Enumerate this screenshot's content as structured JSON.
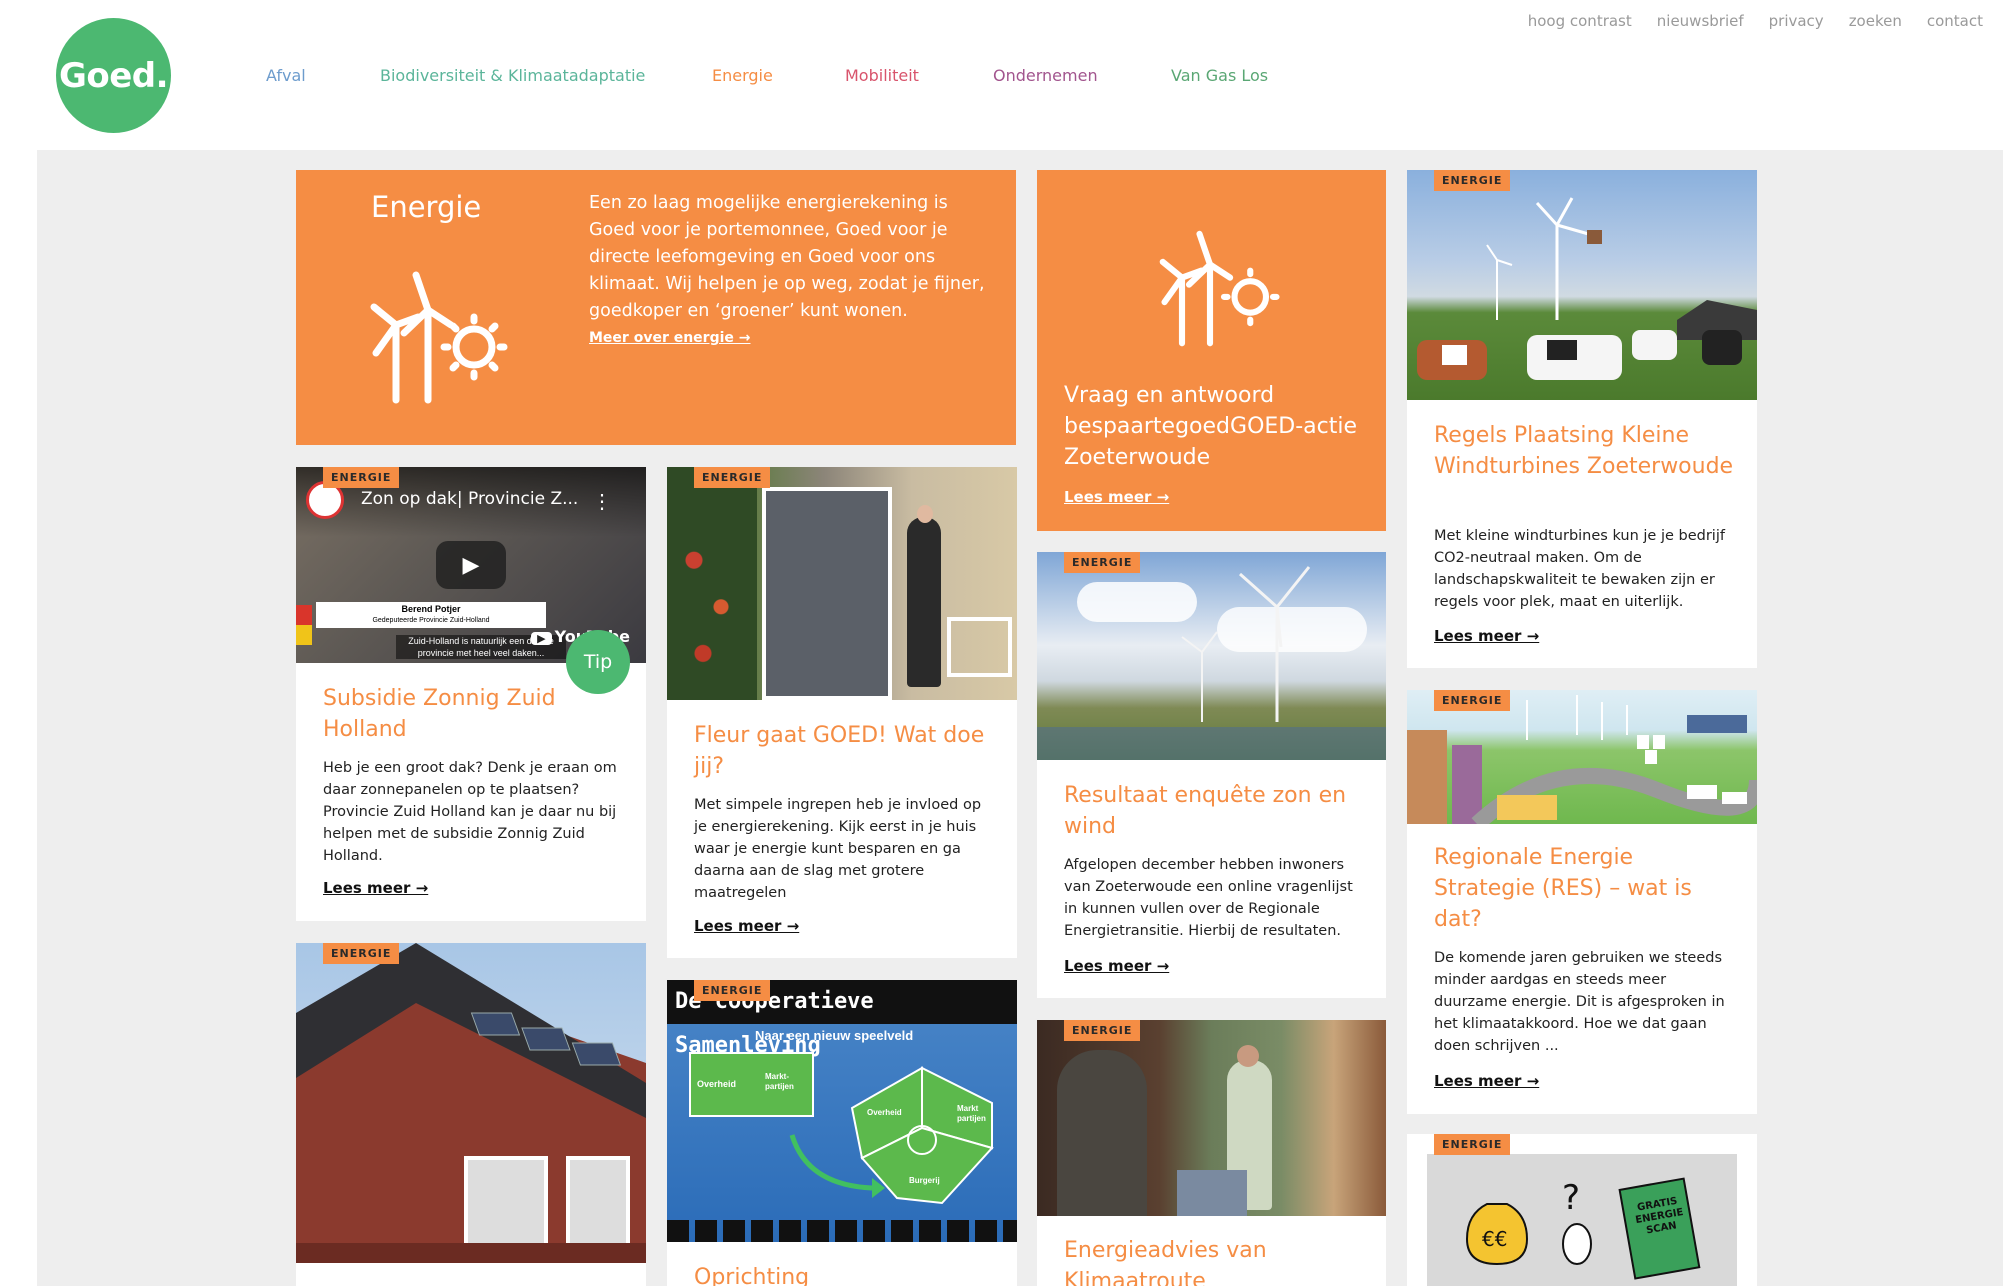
{
  "logo": {
    "text": "Goed."
  },
  "main_nav": [
    {
      "label": "Afval",
      "color": "#6d9ccd"
    },
    {
      "label": "Biodiversiteit & Klimaatadaptatie",
      "color": "#5bb59a"
    },
    {
      "label": "Energie",
      "color": "#f58d44"
    },
    {
      "label": "Mobiliteit",
      "color": "#d8546c"
    },
    {
      "label": "Ondernemen",
      "color": "#a2558e"
    },
    {
      "label": "Van Gas Los",
      "color": "#5aa774"
    }
  ],
  "top_nav": [
    "hoog contrast",
    "nieuwsbrief",
    "privacy",
    "zoeken",
    "contact"
  ],
  "colors": {
    "accent": "#f58d44",
    "green": "#4cb871",
    "bg": "#eeeeee"
  },
  "intro": {
    "title": "Energie",
    "text": "Een zo laag mogelijke energierekening is Goed voor je portemonnee, Goed voor je directe leefomgeving en Goed voor ons klimaat. Wij helpen je op weg, zodat je fijner, goedkoper en ‘groener’ kunt wonen.",
    "link": "Meer over energie →",
    "icon": "wind-solar-icon"
  },
  "badge": "ENERGIE",
  "tip": "Tip",
  "video": {
    "title": "Zon op dak| Provincie Z...",
    "name": "Berend Potjer",
    "role": "Gedeputeerde Provincie Zuid-Holland",
    "caption1": "Zuid-Holland is natuurlijk een drukke",
    "caption2": "provincie met heel veel daken...",
    "brand": "YouTube"
  },
  "cards": {
    "subsidie": {
      "title": "Subsidie Zonnig Zuid Holland",
      "text": "Heb je een groot dak? Denk je eraan om daar zonnepanelen op te plaatsen? Provincie Zuid Holland kan je daar nu bij helpen met de subsidie Zonnig Zuid Holland.",
      "more": "Lees meer →"
    },
    "fleur": {
      "title": "Fleur gaat GOED! Wat doe jij?",
      "text": "Met simpele ingrepen heb je invloed op je energierekening. Kijk eerst in je huis waar je energie kunt besparen en ga daarna aan de slag met grotere maatregelen",
      "more": "Lees meer →"
    },
    "vraag": {
      "title": "Vraag en antwoord bespaartegoedGOED-actie Zoeterwoude",
      "more": "Lees meer →"
    },
    "resultaat": {
      "title": "Resultaat enquête zon en wind",
      "text": "Afgelopen december hebben inwoners van Zoeterwoude een online vragenlijst in kunnen vullen over de Regionale Energietransitie. Hierbij de resultaten.",
      "more": "Lees meer →"
    },
    "advies": {
      "title": "Energieadvies van Klimaatroute"
    },
    "regels": {
      "title": "Regels Plaatsing Kleine Windturbines Zoeterwoude",
      "text": "Met kleine windturbines kun je je bedrijf CO2-neutraal maken. Om de landschapskwaliteit te bewaken zijn er regels voor plek, maat en uiterlijk.",
      "more": "Lees meer →"
    },
    "res": {
      "title": "Regionale Energie Strategie (RES) – wat is dat?",
      "text": "De komende jaren gebruiken we steeds minder aardgas en steeds meer duurzame energie. Dit is afgesproken in het klimaatakkoord. Hoe we dat gaan doen schrijven ...",
      "more": "Lees meer →"
    },
    "coop": {
      "title": "Oprichting",
      "banner": "De coöperatieve Samenleving",
      "sub": "Naar een nieuw speelveld",
      "label1": "Overheid",
      "label2": "Markt-partijen",
      "label3": "Overheid",
      "label4": "Markt partijen",
      "label5": "Burgerij"
    },
    "scan": {
      "stamp": "GRATIS ENERGIE SCAN"
    }
  }
}
